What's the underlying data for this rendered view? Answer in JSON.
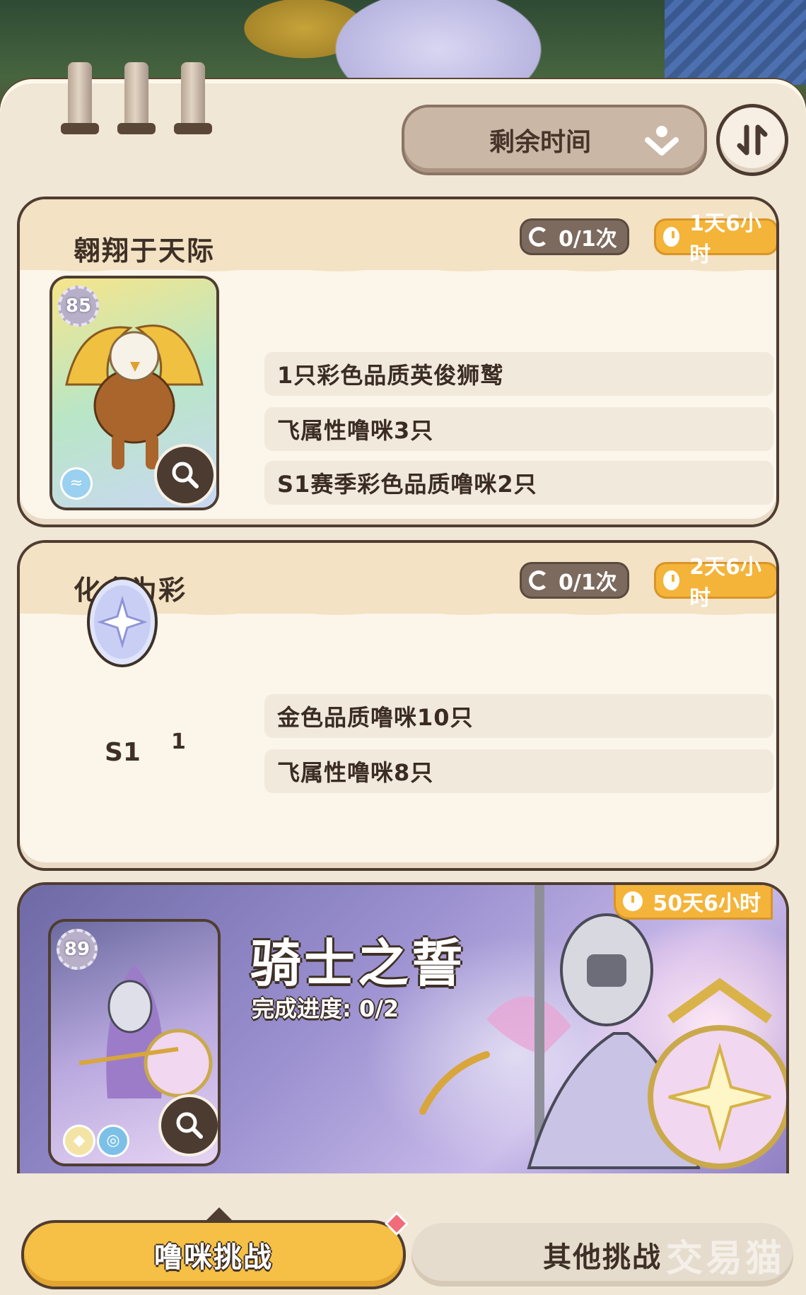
{
  "sort": {
    "label": "剩余时间"
  },
  "challenges": [
    {
      "title": "翱翔于天际",
      "attempts": "0/1次",
      "time_left": "1天6小时",
      "card_level": "85",
      "requirements": [
        "1只彩色品质英俊狮鹫",
        "飞属性噜咪3只",
        "S1赛季彩色品质噜咪2只"
      ]
    },
    {
      "title": "化金为彩",
      "attempts": "0/1次",
      "time_left": "2天6小时",
      "reward_label": "S1",
      "reward_qty": "1",
      "requirements": [
        "金色品质噜咪10只",
        "飞属性噜咪8只"
      ]
    }
  ],
  "featured": {
    "title": "骑士之誓",
    "progress_label": "完成进度: 0/2",
    "time_left": "50天6小时",
    "card_level": "89"
  },
  "tabs": {
    "active": "噜咪挑战",
    "other": "其他挑战"
  },
  "watermark": "交易猫",
  "colors": {
    "accent": "#f5c045",
    "panel": "#f1e7d6",
    "outline": "#4f3d31",
    "timer": "#f4b43a"
  }
}
